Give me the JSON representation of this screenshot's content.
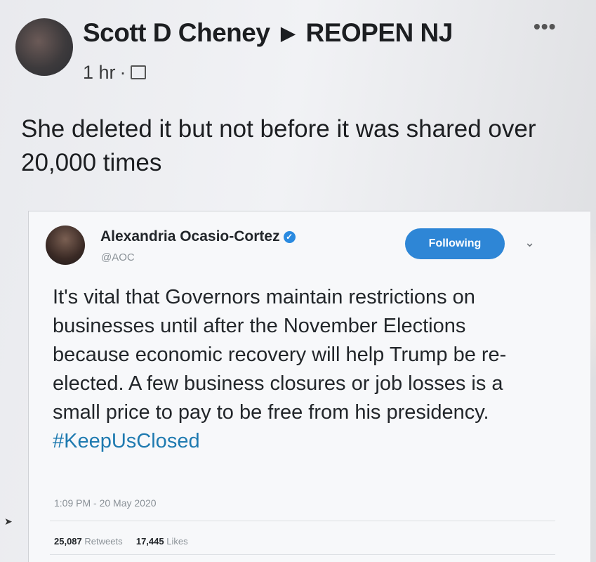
{
  "post": {
    "author": "Scott D Cheney",
    "group": "REOPEN NJ",
    "time": "1 hr",
    "separator": "·",
    "more": "•••",
    "text": "She deleted it but not before it was shared over 20,000 times"
  },
  "tweet": {
    "name": "Alexandria Ocasio-Cortez",
    "handle": "@AOC",
    "follow_label": "Following",
    "text": "It's vital that Governors maintain restrictions on businesses until after the November Elections because economic recovery will help Trump be re-elected. A few business closures or job losses is a small price to pay to be free from his presidency.",
    "hashtag": "#KeepUsClosed",
    "timestamp": "1:09 PM - 20 May 2020",
    "retweets_count": "25,087",
    "retweets_label": "Retweets",
    "likes_count": "17,445",
    "likes_label": "Likes"
  }
}
